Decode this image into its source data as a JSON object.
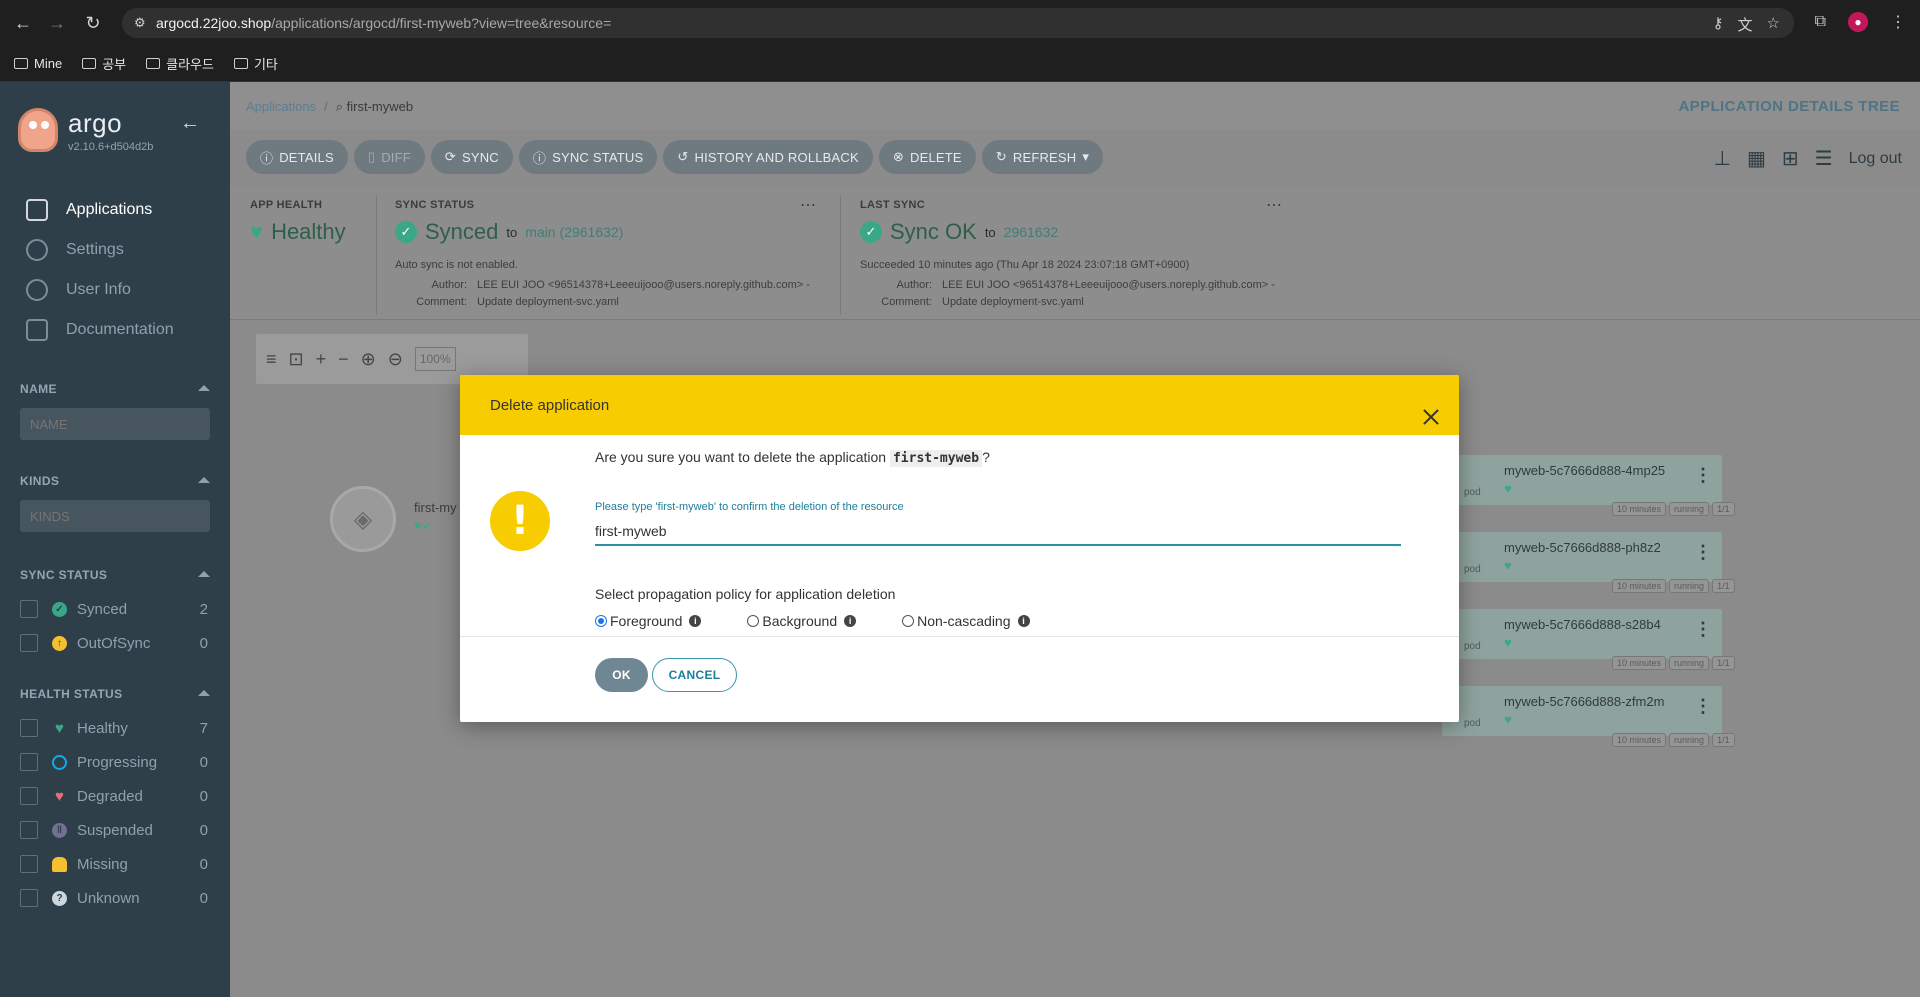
{
  "browser": {
    "url_host": "argocd.22joo.shop",
    "url_path": "/applications/argocd/first-myweb?view=tree&resource=",
    "bookmarks": [
      "Mine",
      "공부",
      "클라우드",
      "기타"
    ]
  },
  "sidebar": {
    "logo_name": "argo",
    "version": "v2.10.6+d504d2b",
    "nav": [
      {
        "label": "Applications",
        "icon": "applications-icon"
      },
      {
        "label": "Settings",
        "icon": "gear-icon"
      },
      {
        "label": "User Info",
        "icon": "user-icon"
      },
      {
        "label": "Documentation",
        "icon": "book-icon"
      }
    ],
    "name_filter": {
      "title": "NAME",
      "placeholder": "NAME"
    },
    "kinds_filter": {
      "title": "KINDS",
      "placeholder": "KINDS"
    },
    "sync_status": {
      "title": "SYNC STATUS",
      "items": [
        {
          "label": "Synced",
          "count": "2",
          "color": "#3aa886"
        },
        {
          "label": "OutOfSync",
          "count": "0",
          "color": "#f4c030"
        }
      ]
    },
    "health_status": {
      "title": "HEALTH STATUS",
      "items": [
        {
          "label": "Healthy",
          "count": "7",
          "color": "#3aa886"
        },
        {
          "label": "Progressing",
          "count": "0",
          "color": "#0dadea"
        },
        {
          "label": "Degraded",
          "count": "0",
          "color": "#e96d76"
        },
        {
          "label": "Suspended",
          "count": "0",
          "color": "#766f94"
        },
        {
          "label": "Missing",
          "count": "0",
          "color": "#f4c030"
        },
        {
          "label": "Unknown",
          "count": "0",
          "color": "#ccd6dd"
        }
      ]
    }
  },
  "breadcrumb": {
    "root": "Applications",
    "current": "first-myweb"
  },
  "page_title": "APPLICATION DETAILS TREE",
  "actions": [
    "DETAILS",
    "DIFF",
    "SYNC",
    "SYNC STATUS",
    "HISTORY AND ROLLBACK",
    "DELETE",
    "REFRESH"
  ],
  "logout": "Log out",
  "app_health": {
    "label": "APP HEALTH",
    "value": "Healthy"
  },
  "sync_status": {
    "label": "SYNC STATUS",
    "value": "Synced",
    "to": "to",
    "revision": "main (2961632)",
    "note": "Auto sync is not enabled.",
    "author_key": "Author:",
    "author": "LEE EUI JOO <96514378+Leeeuijooo@users.noreply.github.com> -",
    "comment_key": "Comment:",
    "comment": "Update deployment-svc.yaml"
  },
  "last_sync": {
    "label": "LAST SYNC",
    "value": "Sync OK",
    "to": "to",
    "revision": "2961632",
    "note": "Succeeded 10 minutes ago (Thu Apr 18 2024 23:07:18 GMT+0900)",
    "author_key": "Author:",
    "author": "LEE EUI JOO <96514378+Leeeuijooo@users.noreply.github.com> -",
    "comment_key": "Comment:",
    "comment": "Update deployment-svc.yaml"
  },
  "zoom": "100%",
  "app_node": {
    "name": "first-my"
  },
  "pods": [
    {
      "name": "myweb-5c7666d888-4mp25",
      "kind": "pod",
      "tags": [
        "10 minutes",
        "running",
        "1/1"
      ]
    },
    {
      "name": "myweb-5c7666d888-ph8z2",
      "kind": "pod",
      "tags": [
        "10 minutes",
        "running",
        "1/1"
      ]
    },
    {
      "name": "myweb-5c7666d888-s28b4",
      "kind": "pod",
      "tags": [
        "10 minutes",
        "running",
        "1/1"
      ]
    },
    {
      "name": "myweb-5c7666d888-zfm2m",
      "kind": "pod",
      "tags": [
        "10 minutes",
        "running",
        "1/1"
      ]
    }
  ],
  "modal": {
    "title": "Delete application",
    "question_prefix": "Are you sure you want to delete the application",
    "app_name": "first-myweb",
    "question_suffix": "?",
    "confirm_label": "Please type 'first-myweb' to confirm the deletion of the resource",
    "confirm_value": "first-myweb",
    "policy_title": "Select propagation policy for application deletion",
    "policies": [
      {
        "label": "Foreground",
        "checked": true
      },
      {
        "label": "Background",
        "checked": false
      },
      {
        "label": "Non-cascading",
        "checked": false
      }
    ],
    "ok": "OK",
    "cancel": "CANCEL"
  },
  "colors": {
    "accent": "#f7cc00",
    "healthy": "#3aa886",
    "link": "#1b7f9a"
  }
}
